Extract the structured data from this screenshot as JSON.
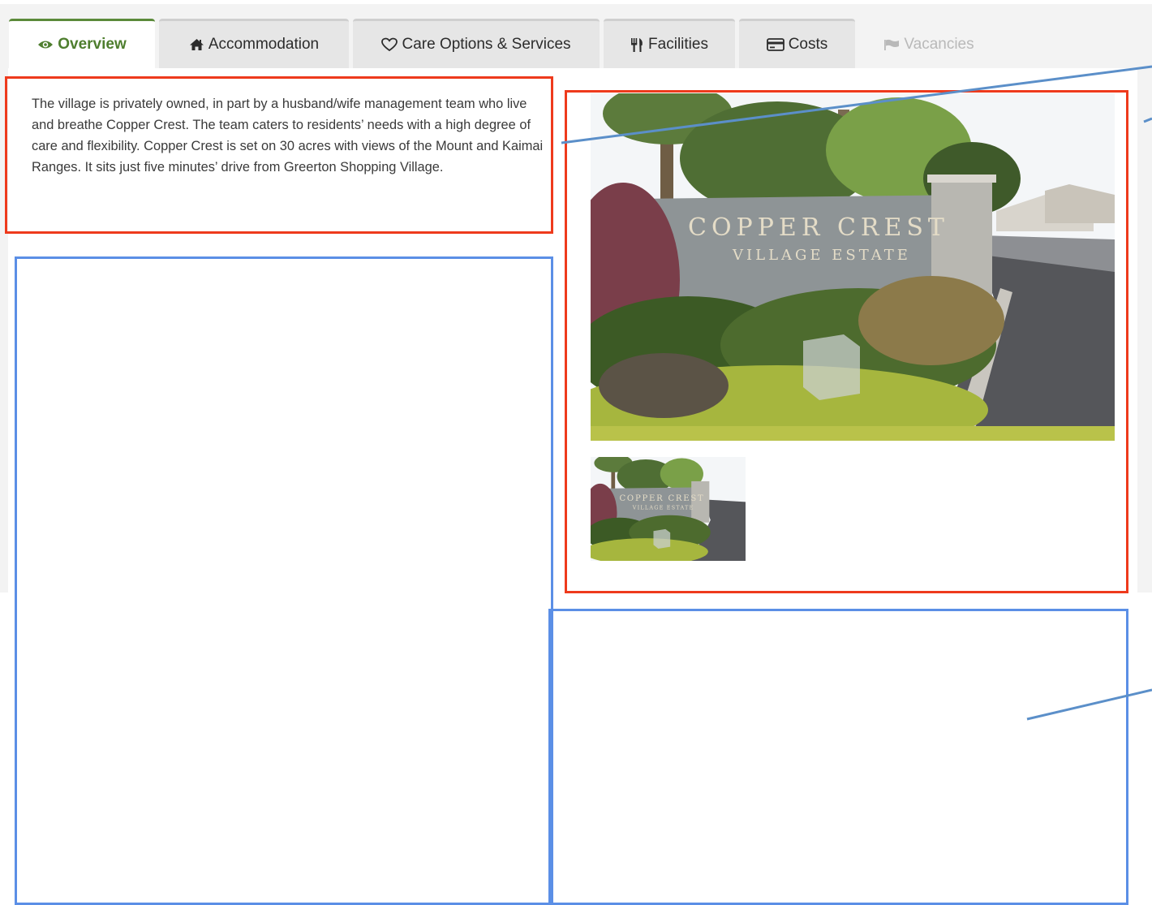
{
  "tabs": [
    {
      "label": "Overview",
      "icon": "eye-icon",
      "state": "active"
    },
    {
      "label": "Accommodation",
      "icon": "home-icon",
      "state": "normal"
    },
    {
      "label": "Care Options & Services",
      "icon": "heart-icon",
      "state": "normal"
    },
    {
      "label": "Facilities",
      "icon": "cutlery-icon",
      "state": "normal"
    },
    {
      "label": "Costs",
      "icon": "credit-card-icon",
      "state": "normal"
    },
    {
      "label": "Vacancies",
      "icon": "flag-icon",
      "state": "disabled"
    }
  ],
  "overview": {
    "description": "The village is privately owned, in part by a husband/wife management team who live and breathe Copper Crest. The team caters to residents’ needs with a high degree of care and flexibility. Copper Crest is set on 30 acres with views of the Mount and Kaimai Ranges. It sits just five minutes’ drive from Greerton Shopping Village."
  },
  "gallery": {
    "sign_line1": "COPPER CREST",
    "sign_line2": "VILLAGE ESTATE"
  },
  "colors": {
    "active_tab": "#4e7e2e",
    "annotation_red": "#ee3a1c",
    "annotation_blue": "#5b8fe6",
    "disabled_tab": "#b9b9b9"
  }
}
